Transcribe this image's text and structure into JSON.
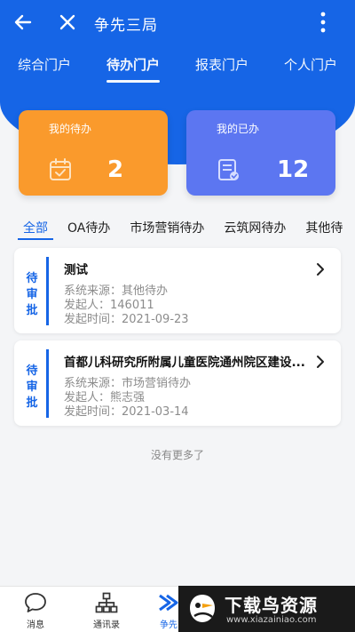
{
  "topbar": {
    "title": "争先三局"
  },
  "portal_tabs": [
    {
      "label": "综合门户",
      "active": false
    },
    {
      "label": "待办门户",
      "active": true
    },
    {
      "label": "报表门户",
      "active": false
    },
    {
      "label": "个人门户",
      "active": false
    }
  ],
  "stats": {
    "todo": {
      "label": "我的待办",
      "count": "2",
      "icon": "calendar-check-icon",
      "color": "#fa9a2c"
    },
    "done": {
      "label": "我的已办",
      "count": "12",
      "icon": "document-check-icon",
      "color": "#5c76f1"
    }
  },
  "category_tabs": [
    {
      "label": "全部",
      "active": true
    },
    {
      "label": "OA待办",
      "active": false
    },
    {
      "label": "市场营销待办",
      "active": false
    },
    {
      "label": "云筑网待办",
      "active": false
    },
    {
      "label": "其他待",
      "active": false
    }
  ],
  "tasks": [
    {
      "status": "待审批",
      "title": "测试",
      "source": "系统来源：其他待办",
      "initiator": "发起人：146011",
      "time": "发起时间：2021-09-23"
    },
    {
      "status": "待审批",
      "title": "首都儿科研究所附属儿童医院通州院区建设...",
      "source": "系统来源：市场营销待办",
      "initiator": "发起人：熊志强",
      "time": "发起时间：2021-03-14"
    }
  ],
  "no_more_text": "没有更多了",
  "bottom_nav": [
    {
      "label": "消息",
      "icon": "chat-bubble-icon"
    },
    {
      "label": "通讯录",
      "icon": "org-chart-icon"
    },
    {
      "label": "争先",
      "icon": "zhengxian-icon",
      "active": true
    }
  ],
  "watermark": {
    "title": "下载鸟资源",
    "url": "www.xiazainiao.com"
  },
  "colors": {
    "brand": "#1665e6"
  }
}
